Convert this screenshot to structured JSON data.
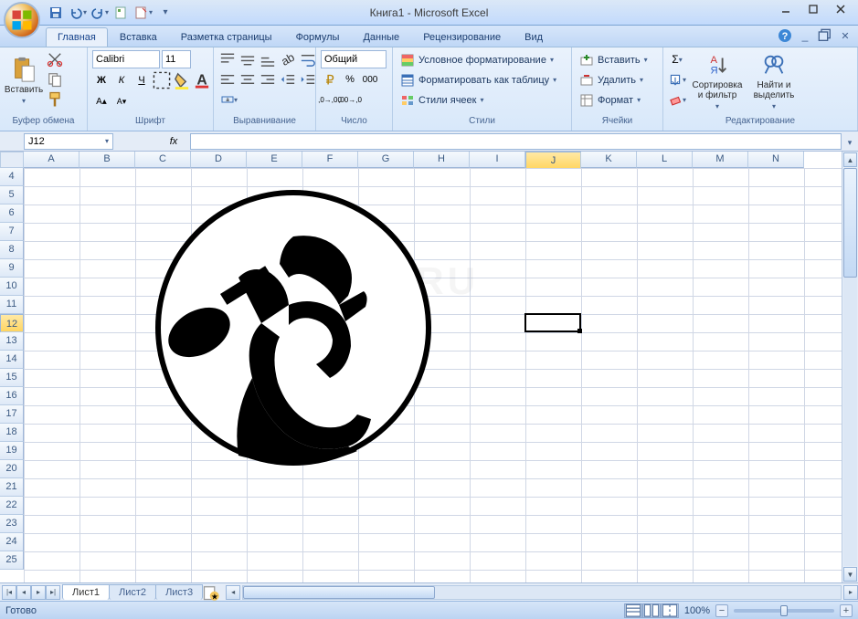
{
  "title": "Книга1 - Microsoft Excel",
  "qat": {
    "save": "save-icon",
    "undo": "undo-icon",
    "redo": "redo-icon",
    "q4": "qat-icon",
    "q5": "qat-icon"
  },
  "tabs": [
    "Главная",
    "Вставка",
    "Разметка страницы",
    "Формулы",
    "Данные",
    "Рецензирование",
    "Вид"
  ],
  "active_tab": 0,
  "ribbon": {
    "clipboard": {
      "title": "Буфер обмена",
      "paste": "Вставить"
    },
    "font": {
      "title": "Шрифт",
      "name": "Calibri",
      "size": "11",
      "bold": "Ж",
      "italic": "К",
      "underline": "Ч"
    },
    "alignment": {
      "title": "Выравнивание"
    },
    "number": {
      "title": "Число",
      "format": "Общий"
    },
    "styles": {
      "title": "Стили",
      "cond": "Условное форматирование",
      "table": "Форматировать как таблицу",
      "cell": "Стили ячеек"
    },
    "cells": {
      "title": "Ячейки",
      "insert": "Вставить",
      "delete": "Удалить",
      "format": "Формат"
    },
    "editing": {
      "title": "Редактирование",
      "sort": "Сортировка и фильтр",
      "find": "Найти и выделить"
    }
  },
  "namebox": "J12",
  "fx": "fx",
  "columns": [
    "A",
    "B",
    "C",
    "D",
    "E",
    "F",
    "G",
    "H",
    "I",
    "J",
    "K",
    "L",
    "M",
    "N"
  ],
  "rows": [
    "4",
    "5",
    "6",
    "7",
    "8",
    "9",
    "10",
    "11",
    "12",
    "13",
    "14",
    "15",
    "16",
    "17",
    "18",
    "19",
    "20",
    "21",
    "22",
    "23",
    "24",
    "25"
  ],
  "selected_col_idx": 9,
  "selected_row_idx": 8,
  "sheets": [
    "Лист1",
    "Лист2",
    "Лист3"
  ],
  "active_sheet": 0,
  "status": "Готово",
  "zoom": "100%",
  "watermark": "SYSADMIN.RU"
}
